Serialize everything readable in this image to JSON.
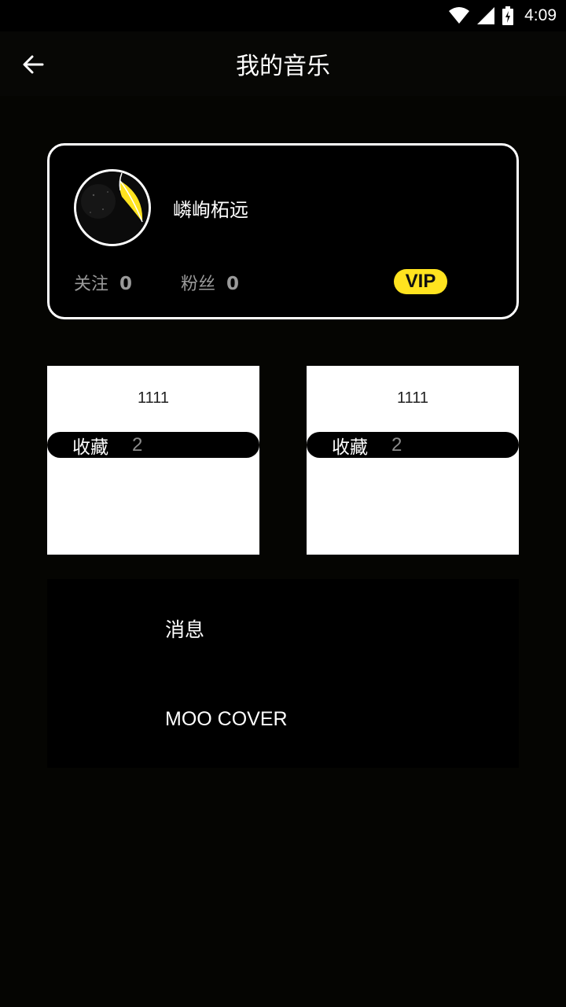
{
  "status_bar": {
    "time": "4:09"
  },
  "app_bar": {
    "title": "我的音乐"
  },
  "profile": {
    "username": "嶙峋柘远",
    "following_label": "关注",
    "following_count": "0",
    "fans_label": "粉丝",
    "fans_count": "0",
    "vip_label": "VIP"
  },
  "tiles": [
    {
      "title": "1111",
      "label": "收藏",
      "count": "2"
    },
    {
      "title": "1111",
      "label": "收藏",
      "count": "2"
    }
  ],
  "menu": {
    "items": [
      {
        "label": "消息"
      },
      {
        "label": "MOO COVER"
      }
    ]
  },
  "colors": {
    "accent": "#ffe31f",
    "background": "#050502",
    "card": "#000000",
    "muted_text": "#9a9a9a"
  }
}
